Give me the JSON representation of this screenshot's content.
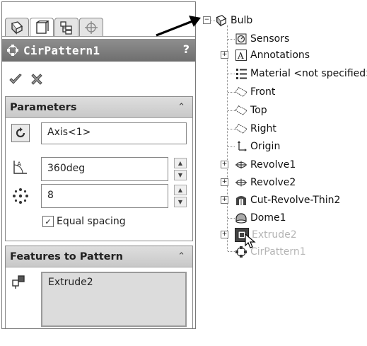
{
  "property_manager": {
    "tabs": [
      {
        "icon": "feature-manager-icon"
      },
      {
        "icon": "property-manager-icon"
      },
      {
        "icon": "configuration-manager-icon"
      },
      {
        "icon": "dimxpert-icon"
      }
    ],
    "title": "CirPattern1",
    "help_label": "?",
    "parameters": {
      "header": "Parameters",
      "axis_value": "Axis<1>",
      "angle_value": "360deg",
      "instances_value": "8",
      "equal_spacing_label": "Equal spacing",
      "equal_spacing_checked": true
    },
    "features_to_pattern": {
      "header": "Features to Pattern",
      "items": [
        "Extrude2"
      ]
    }
  },
  "feature_tree": {
    "root": "Bulb",
    "items": [
      {
        "label": "Sensors",
        "icon": "sensors-icon",
        "expandable": false
      },
      {
        "label": "Annotations",
        "icon": "annotations-icon",
        "expandable": true
      },
      {
        "label": "Material <not specified>",
        "icon": "material-icon",
        "expandable": false
      },
      {
        "label": "Front",
        "icon": "plane-icon",
        "expandable": false
      },
      {
        "label": "Top",
        "icon": "plane-icon",
        "expandable": false
      },
      {
        "label": "Right",
        "icon": "plane-icon",
        "expandable": false
      },
      {
        "label": "Origin",
        "icon": "origin-icon",
        "expandable": false
      },
      {
        "label": "Revolve1",
        "icon": "revolve-icon",
        "expandable": true
      },
      {
        "label": "Revolve2",
        "icon": "revolve-icon",
        "expandable": true
      },
      {
        "label": "Cut-Revolve-Thin2",
        "icon": "cut-revolve-icon",
        "expandable": true
      },
      {
        "label": "Dome1",
        "icon": "dome-icon",
        "expandable": false
      },
      {
        "label": "Extrude2",
        "icon": "extrude-icon",
        "expandable": true,
        "selected_in_pattern": true
      },
      {
        "label": "CirPattern1",
        "icon": "circular-pattern-icon",
        "expandable": false,
        "preview": true
      }
    ]
  }
}
